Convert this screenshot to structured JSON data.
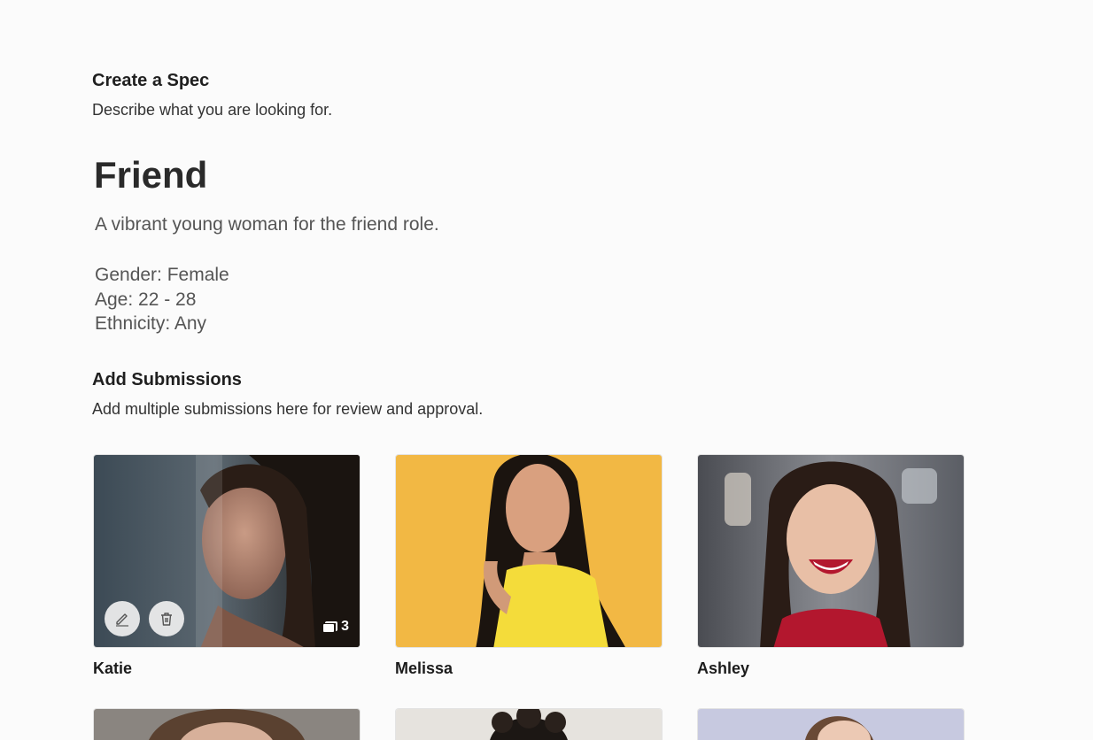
{
  "spec_section": {
    "title": "Create a Spec",
    "subtitle": "Describe what you are looking for."
  },
  "spec": {
    "title": "Friend",
    "description": "A vibrant young woman for the friend role.",
    "attributes": [
      "Gender: Female",
      "Age: 22 - 28",
      "Ethnicity: Any"
    ]
  },
  "submissions_section": {
    "title": "Add Submissions",
    "subtitle": "Add multiple submissions here for review and approval."
  },
  "submissions": [
    {
      "name": "Katie",
      "photo_count": "3",
      "icons": [
        "pencil-icon",
        "trash-icon",
        "photo-stack-icon"
      ]
    },
    {
      "name": "Melissa"
    },
    {
      "name": "Ashley"
    }
  ],
  "colors": {
    "page_background": "#fbfbfb",
    "melissa_photo_background": "#f2b844",
    "ashley_top_accent": "#b3172e"
  }
}
